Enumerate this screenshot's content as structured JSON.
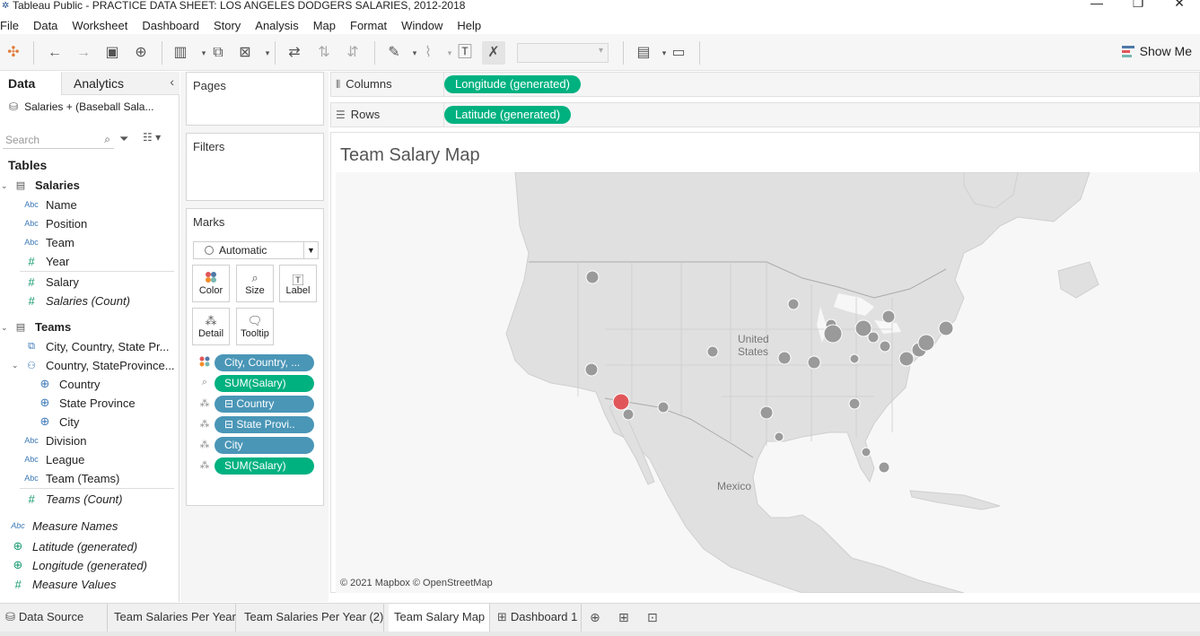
{
  "window": {
    "title": "Tableau Public - PRACTICE DATA SHEET: LOS ANGELES DODGERS SALARIES, 2012-2018",
    "controls": [
      "minimize",
      "restore",
      "close"
    ]
  },
  "menu": [
    "File",
    "Data",
    "Worksheet",
    "Dashboard",
    "Story",
    "Analysis",
    "Map",
    "Format",
    "Window",
    "Help"
  ],
  "toolbar": {
    "show_me": "Show Me"
  },
  "data_pane": {
    "tab_data": "Data",
    "tab_analytics": "Analytics",
    "source": "Salaries + (Baseball Sala...",
    "search_placeholder": "Search",
    "tables_title": "Tables",
    "salaries_table": "Salaries",
    "salaries_fields": [
      {
        "type": "Abc",
        "name": "Name"
      },
      {
        "type": "Abc",
        "name": "Position"
      },
      {
        "type": "Abc",
        "name": "Team"
      },
      {
        "type": "#",
        "name": "Year"
      },
      {
        "type": "#",
        "name": "Salary"
      },
      {
        "type": "#",
        "name": "Salaries (Count)"
      }
    ],
    "teams_table": "Teams",
    "teams_fields": {
      "combined": "City, Country, State Pr...",
      "hierarchy": "Country, StateProvince...",
      "country": "Country",
      "state": "State Province",
      "city": "City",
      "division": "Division",
      "league": "League",
      "team_teams": "Team (Teams)",
      "teams_count": "Teams (Count)"
    },
    "abc": "Abc",
    "hash": "#",
    "extras": {
      "measure_names": "Measure Names",
      "latitude": "Latitude (generated)",
      "longitude": "Longitude (generated)",
      "measure_values": "Measure Values"
    }
  },
  "cards": {
    "pages": "Pages",
    "filters": "Filters",
    "marks": "Marks",
    "mark_type": "Automatic",
    "buttons": [
      "Color",
      "Size",
      "Label",
      "Detail",
      "Tooltip"
    ],
    "pills": [
      {
        "label": "City, Country, ...",
        "kind": "dim",
        "enc": "color"
      },
      {
        "label": "SUM(Salary)",
        "kind": "meas",
        "enc": "size"
      },
      {
        "label": "⊟ Country",
        "kind": "dim",
        "enc": "detail"
      },
      {
        "label": "⊟ State Provi..",
        "kind": "dim",
        "enc": "detail"
      },
      {
        "label": "City",
        "kind": "dim",
        "enc": "detail"
      },
      {
        "label": "SUM(Salary)",
        "kind": "meas",
        "enc": "detail"
      }
    ]
  },
  "shelves": {
    "columns_label": "Columns",
    "columns_pill": "Longitude (generated)",
    "rows_label": "Rows",
    "rows_pill": "Latitude (generated)"
  },
  "view": {
    "title": "Team Salary Map",
    "attribution": "© 2021 Mapbox © OpenStreetMap",
    "labels": {
      "us": "United States",
      "mexico": "Mexico"
    },
    "colors": {
      "mark": "#9a9a9a",
      "highlight": "#e15759",
      "land": "#e0e0e0",
      "water": "#f7f7f7"
    }
  },
  "bottom_tabs": {
    "data_source": "Data Source",
    "sheets": [
      "Team Salaries Per Year",
      "Team Salaries Per Year (2)",
      "Team Salary Map"
    ],
    "dashboard": "Dashboard 1",
    "active": "Team Salary Map"
  }
}
